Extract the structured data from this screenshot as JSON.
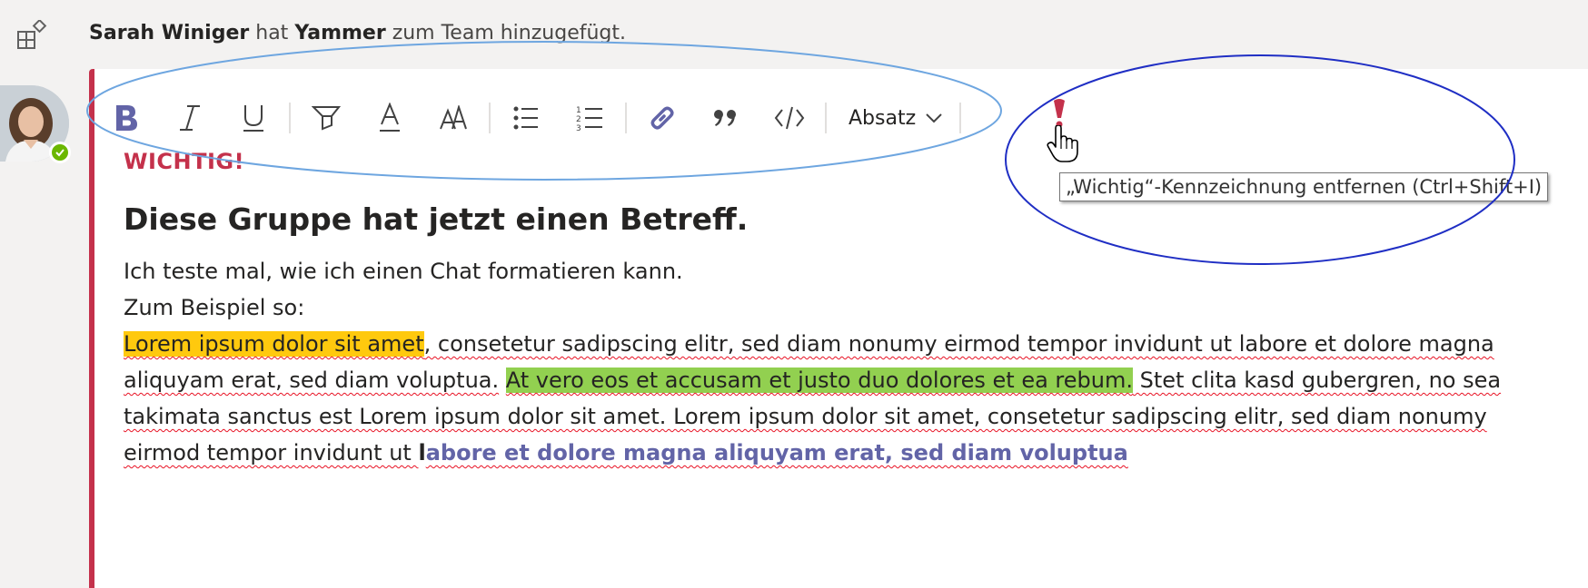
{
  "system_message": {
    "actor": "Sarah Winiger",
    "verb": "hat",
    "app": "Yammer",
    "rest": "zum Team hinzugefügt."
  },
  "toolbar": {
    "paragraph_label": "Absatz"
  },
  "tooltip": "„Wichtig“-Kennzeichnung entfernen (Ctrl+Shift+I)",
  "message": {
    "important_label": "WICHTIG!",
    "subject": "Diese Gruppe hat jetzt einen Betreff.",
    "line1": "Ich teste mal, wie ich einen Chat formatieren kann.",
    "line2": "Zum Beispiel so:",
    "yellow_highlight": "Lorem ipsum dolor sit amet",
    "p1": ", consetetur sadipscing elitr, sed diam nonumy eirmod tempor invidunt ut labore et dolore magna aliquyam erat, sed diam voluptua.",
    "green_highlight": "At vero eos et accusam et justo duo dolores et ea rebum.",
    "p2": " Stet clita kasd gubergren, no sea takimata sanctus est Lorem ipsum dolor sit amet. Lorem ipsum dolor sit amet, consetetur sadipscing elitr, sed diam nonumy eirmod tempor invidunt ut ",
    "bold_black": "l",
    "bold_purple": "abore et dolore magna aliquyam erat, sed diam voluptua"
  },
  "colors": {
    "important_red": "#c4314b",
    "teams_purple": "#6264a7",
    "highlight_yellow": "#ffc90e",
    "highlight_green": "#92d050",
    "presence_green": "#6bb700"
  }
}
